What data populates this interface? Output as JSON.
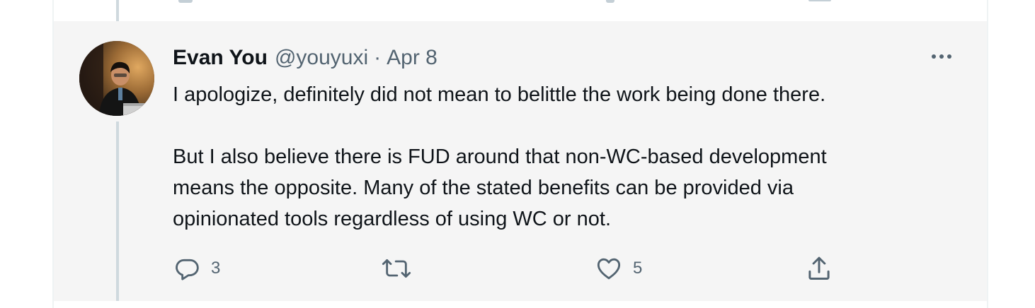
{
  "tweet": {
    "display_name": "Evan You",
    "handle": "@youyuxi",
    "separator": "·",
    "date": "Apr 8",
    "paragraphs": [
      [
        "I apologize, definitely did not mean to belittle the work being done there."
      ],
      [
        "But I also believe there is FUD around that non-WC-based development",
        "means the opposite. Many of the stated benefits can be provided via",
        "opinionated tools regardless of using WC or not."
      ]
    ],
    "actions": {
      "reply_count": "3",
      "retweet_count": "",
      "like_count": "5"
    }
  },
  "icons": {
    "more": "more-horizontal-icon",
    "reply": "reply-bubble-icon",
    "retweet": "retweet-icon",
    "like": "heart-icon",
    "share": "share-icon"
  },
  "colors": {
    "primary_text": "#0f1419",
    "secondary_text": "#536471",
    "highlight_background": "#f5f5f5",
    "thread_line": "#cfd9de"
  }
}
